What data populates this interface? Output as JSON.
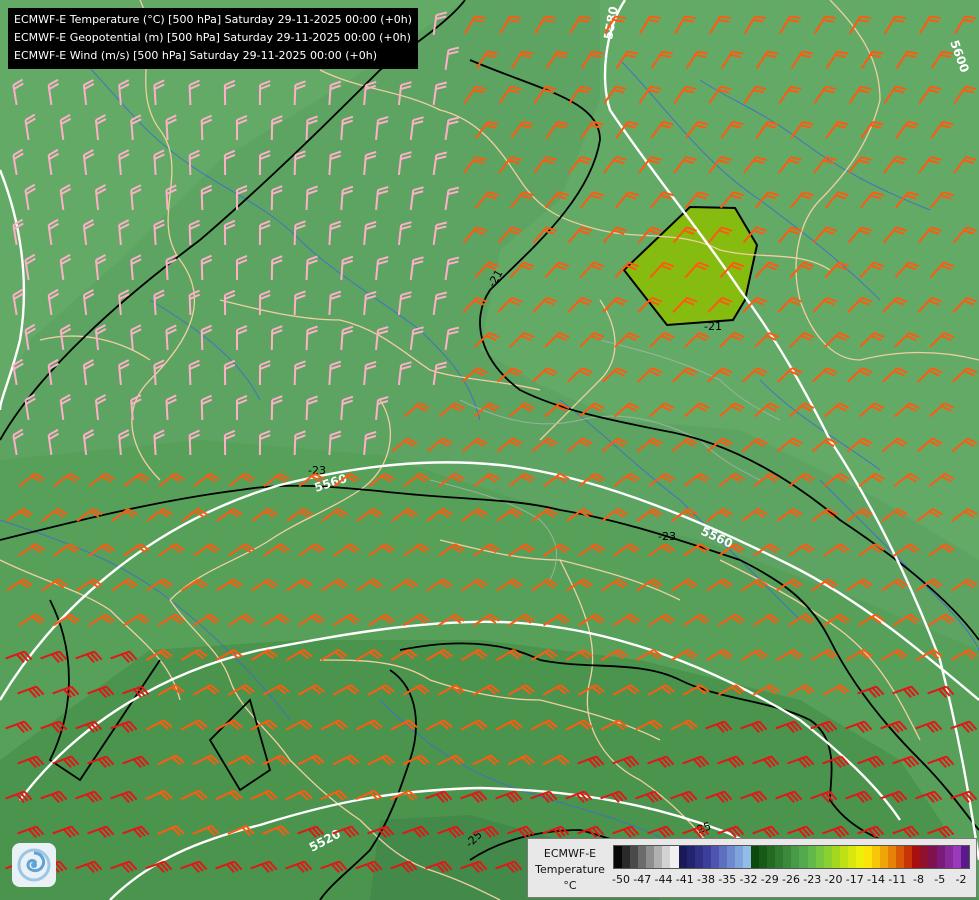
{
  "title_lines": [
    "ECMWF-E Temperature (°C) [500 hPa] Saturday 29-11-2025 00:00 (+0h)",
    "ECMWF-E Geopotential (m) [500 hPa] Saturday 29-11-2025 00:00 (+0h)",
    "ECMWF-E Wind (m/s) [500 hPa] Saturday 29-11-2025 00:00 (+0h)"
  ],
  "legend": {
    "model": "ECMWF-E",
    "variable": "Temperature",
    "unit": "°C",
    "ticks": [
      "-50",
      "-47",
      "-44",
      "-41",
      "-38",
      "-35",
      "-32",
      "-29",
      "-26",
      "-23",
      "-20",
      "-17",
      "-14",
      "-11",
      "-8",
      "-5",
      "-2"
    ],
    "colors": [
      "#070707",
      "#2a2a2a",
      "#4a4a4a",
      "#6c6c6c",
      "#8e8e8e",
      "#b0b0b0",
      "#d2d2d2",
      "#f0f0f0",
      "#1a1a5a",
      "#24246e",
      "#303085",
      "#3d3d9c",
      "#4e55b0",
      "#5f6fc0",
      "#6f89cf",
      "#7fa4dc",
      "#92bde8",
      "#0b4a0b",
      "#175a17",
      "#236a23",
      "#2f7a2f",
      "#3b8a3b",
      "#479a47",
      "#53aa4d",
      "#63b84a",
      "#76c640",
      "#8ad030",
      "#a4d81e",
      "#bfe014",
      "#d8e80e",
      "#eef00a",
      "#fbe40a",
      "#f7c60a",
      "#efa408",
      "#e68208",
      "#d85a06",
      "#c83406",
      "#a81010",
      "#901030",
      "#80104e",
      "#7a1a7a",
      "#8a2a9a",
      "#9a3aba",
      "#5a1a8a"
    ]
  },
  "geopotential_labels": [
    "5580",
    "5600",
    "5560",
    "5560",
    "5520"
  ],
  "temperature_labels": [
    "-21",
    "-21",
    "-23",
    "-23",
    "-25",
    "-25"
  ],
  "colors": {
    "field_light": "#63aa66",
    "field_mid": "#58a05b",
    "field_dark": "#4a924d",
    "field_darker": "#3f8642",
    "warm_patch": "#86bc10",
    "geopotential": "#ffffff",
    "isotherm": "#000000",
    "coastline": "#f0cfa0",
    "river": "#3f6fc8",
    "barb_pink": "#ffb0c8",
    "barb_orange": "#ff5a10",
    "barb_red": "#e01818"
  },
  "icons": {
    "logo": "swirl-logo-icon"
  }
}
